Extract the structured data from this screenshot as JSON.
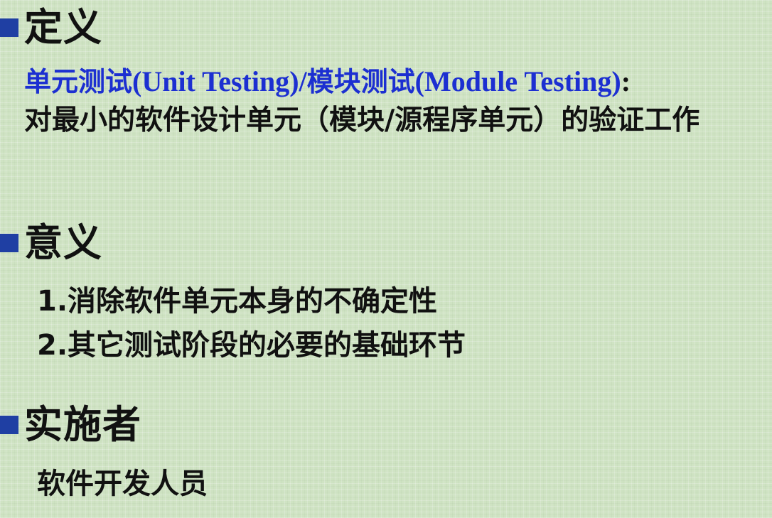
{
  "definition": {
    "heading": "定义",
    "term_cn_1": "单元测试",
    "term_en_1": "(Unit Testing)",
    "slash": "/",
    "term_cn_2": "模块测试",
    "term_en_2": "(Module Testing)",
    "colon": ":",
    "description": "对最小的软件设计单元（模块/源程序单元）的验证工作"
  },
  "significance": {
    "heading": "意义",
    "items": [
      "1.消除软件单元本身的不确定性",
      "2.其它测试阶段的必要的基础环节"
    ]
  },
  "implementer": {
    "heading": "实施者",
    "text": "软件开发人员"
  },
  "colors": {
    "background": "#cfe3c3",
    "bullet": "#1f3fa3",
    "term_blue": "#1c2fd1",
    "text": "#111111"
  }
}
